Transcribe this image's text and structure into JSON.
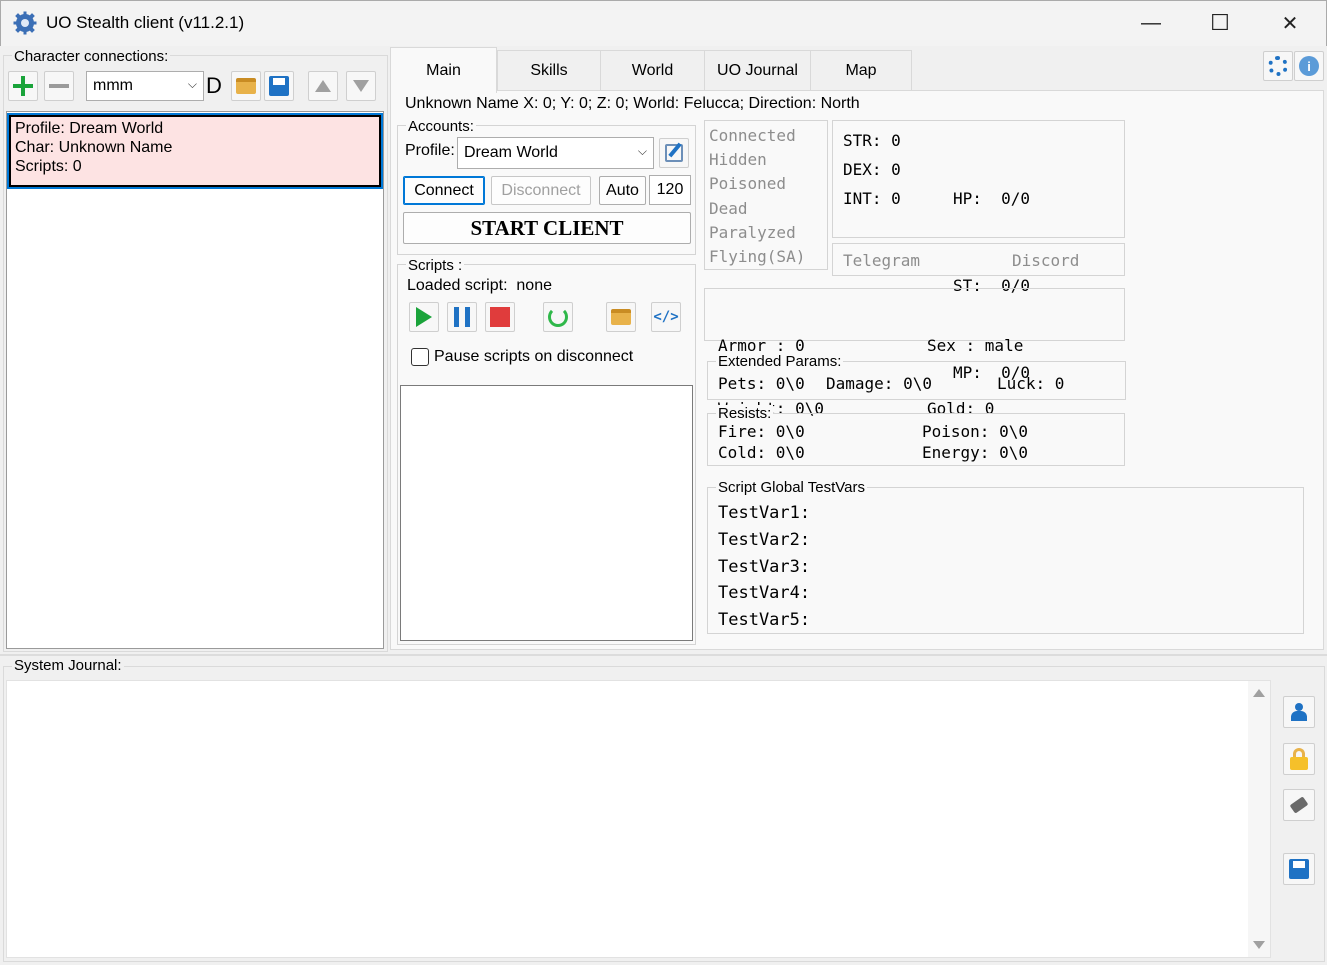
{
  "window": {
    "title": "UO Stealth client (v11.2.1)",
    "minimize_glyph": "—",
    "maximize_glyph": "☐",
    "close_glyph": "✕"
  },
  "connections": {
    "label": "Character connections:",
    "dropdown_value": "mmm",
    "d_label": "D",
    "item": {
      "profile": "Profile: Dream World",
      "char": "Char: Unknown Name",
      "scripts": "Scripts: 0"
    }
  },
  "tabs": [
    "Main",
    "Skills",
    "World",
    "UO Journal",
    "Map"
  ],
  "status_line": "Unknown Name X: 0;  Y: 0;  Z: 0; World: Felucca;  Direction: North",
  "accounts": {
    "label": "Accounts:",
    "profile_label": "Profile:",
    "profile_value": "Dream World",
    "connect": "Connect",
    "disconnect": "Disconnect",
    "auto": "Auto",
    "auto_value": "120",
    "start_client": "START  CLIENT"
  },
  "scripts": {
    "label": "Scripts :",
    "loaded_label": "Loaded script:",
    "loaded_value": "none",
    "pause_checkbox": "Pause scripts on disconnect"
  },
  "status_flags": [
    "Connected",
    "Hidden",
    "Poisoned",
    "Dead",
    "Paralyzed",
    "Flying(SA)"
  ],
  "stats": {
    "str": "STR: 0",
    "dex": "DEX: 0",
    "int": "INT: 0",
    "hp": "HP:  0/0",
    "st": "ST:  0/0",
    "mp": "MP:  0/0"
  },
  "links": {
    "telegram": "Telegram",
    "discord": "Discord"
  },
  "armor": {
    "armor": "Armor : 0",
    "weight": "Weight: 0\\0",
    "sex": "Sex : male",
    "gold": "Gold: 0"
  },
  "extended": {
    "label": "Extended Params:",
    "pets": "Pets: 0\\0",
    "damage": "Damage: 0\\0",
    "luck": "Luck: 0"
  },
  "resists": {
    "label": "Resists:",
    "fire": "Fire: 0\\0",
    "cold": "Cold: 0\\0",
    "poison": "Poison: 0\\0",
    "energy": "Energy: 0\\0"
  },
  "testvars": {
    "label": "Script Global TestVars",
    "items": [
      "TestVar1:",
      "TestVar2:",
      "TestVar3:",
      "TestVar4:",
      "TestVar5:"
    ]
  },
  "journal": {
    "label": "System Journal:"
  },
  "colors": {
    "accent": "#0078d7",
    "selected_bg": "#fde3e3",
    "green": "#1aa33a",
    "blue": "#1f72c4",
    "red": "#e03c3c",
    "folder": "#e8b24a"
  }
}
